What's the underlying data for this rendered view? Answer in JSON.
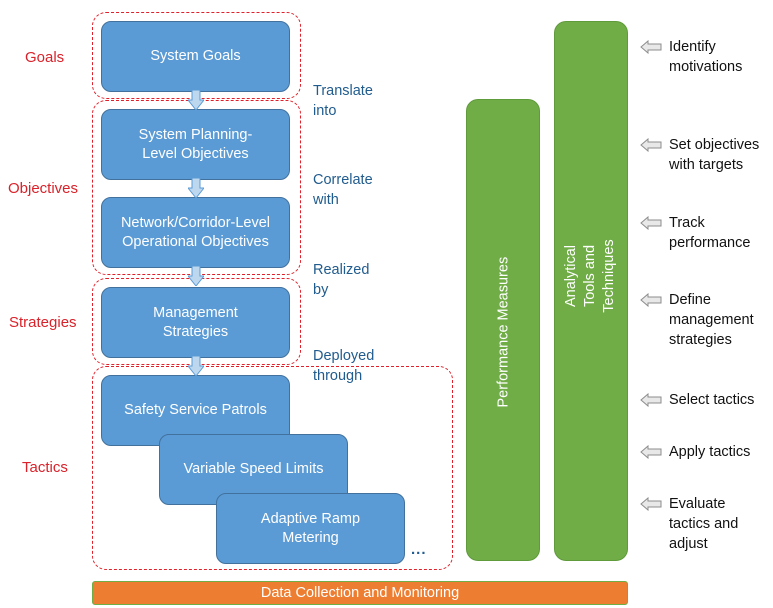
{
  "levels": {
    "goals": "Goals",
    "objectives": "Objectives",
    "strategies": "Strategies",
    "tactics": "Tactics"
  },
  "boxes": {
    "system_goals": "System Goals",
    "planning_objectives": "System Planning-\nLevel Objectives",
    "operational_objectives": "Network/Corridor-Level\nOperational Objectives",
    "management_strategies": "Management\nStrategies",
    "tactic_1": "Safety Service Patrols",
    "tactic_2": "Variable Speed Limits",
    "tactic_3": "Adaptive Ramp\nMetering",
    "more_tactics": "..."
  },
  "connectors": {
    "translate": "Translate\ninto",
    "correlate": "Correlate\nwith",
    "realized": "Realized\nby",
    "deployed": "Deployed\nthrough"
  },
  "vertical_bars": {
    "performance_measures": "Performance Measures",
    "analytical_tools": "Analytical\nTools and\nTechniques"
  },
  "steps": [
    "Identify\nmotivations",
    "Set objectives\nwith targets",
    "Track\nperformance",
    "Define\nmanagement\nstrategies",
    "Select tactics",
    "Apply tactics",
    "Evaluate\ntactics and\nadjust"
  ],
  "foundation": "Data Collection and Monitoring",
  "colors": {
    "box_blue": "#5b9bd5",
    "label_red": "#d9222a",
    "connector_blue": "#215c8e",
    "bar_green": "#70ad47",
    "foundation_orange": "#ed7d31"
  }
}
